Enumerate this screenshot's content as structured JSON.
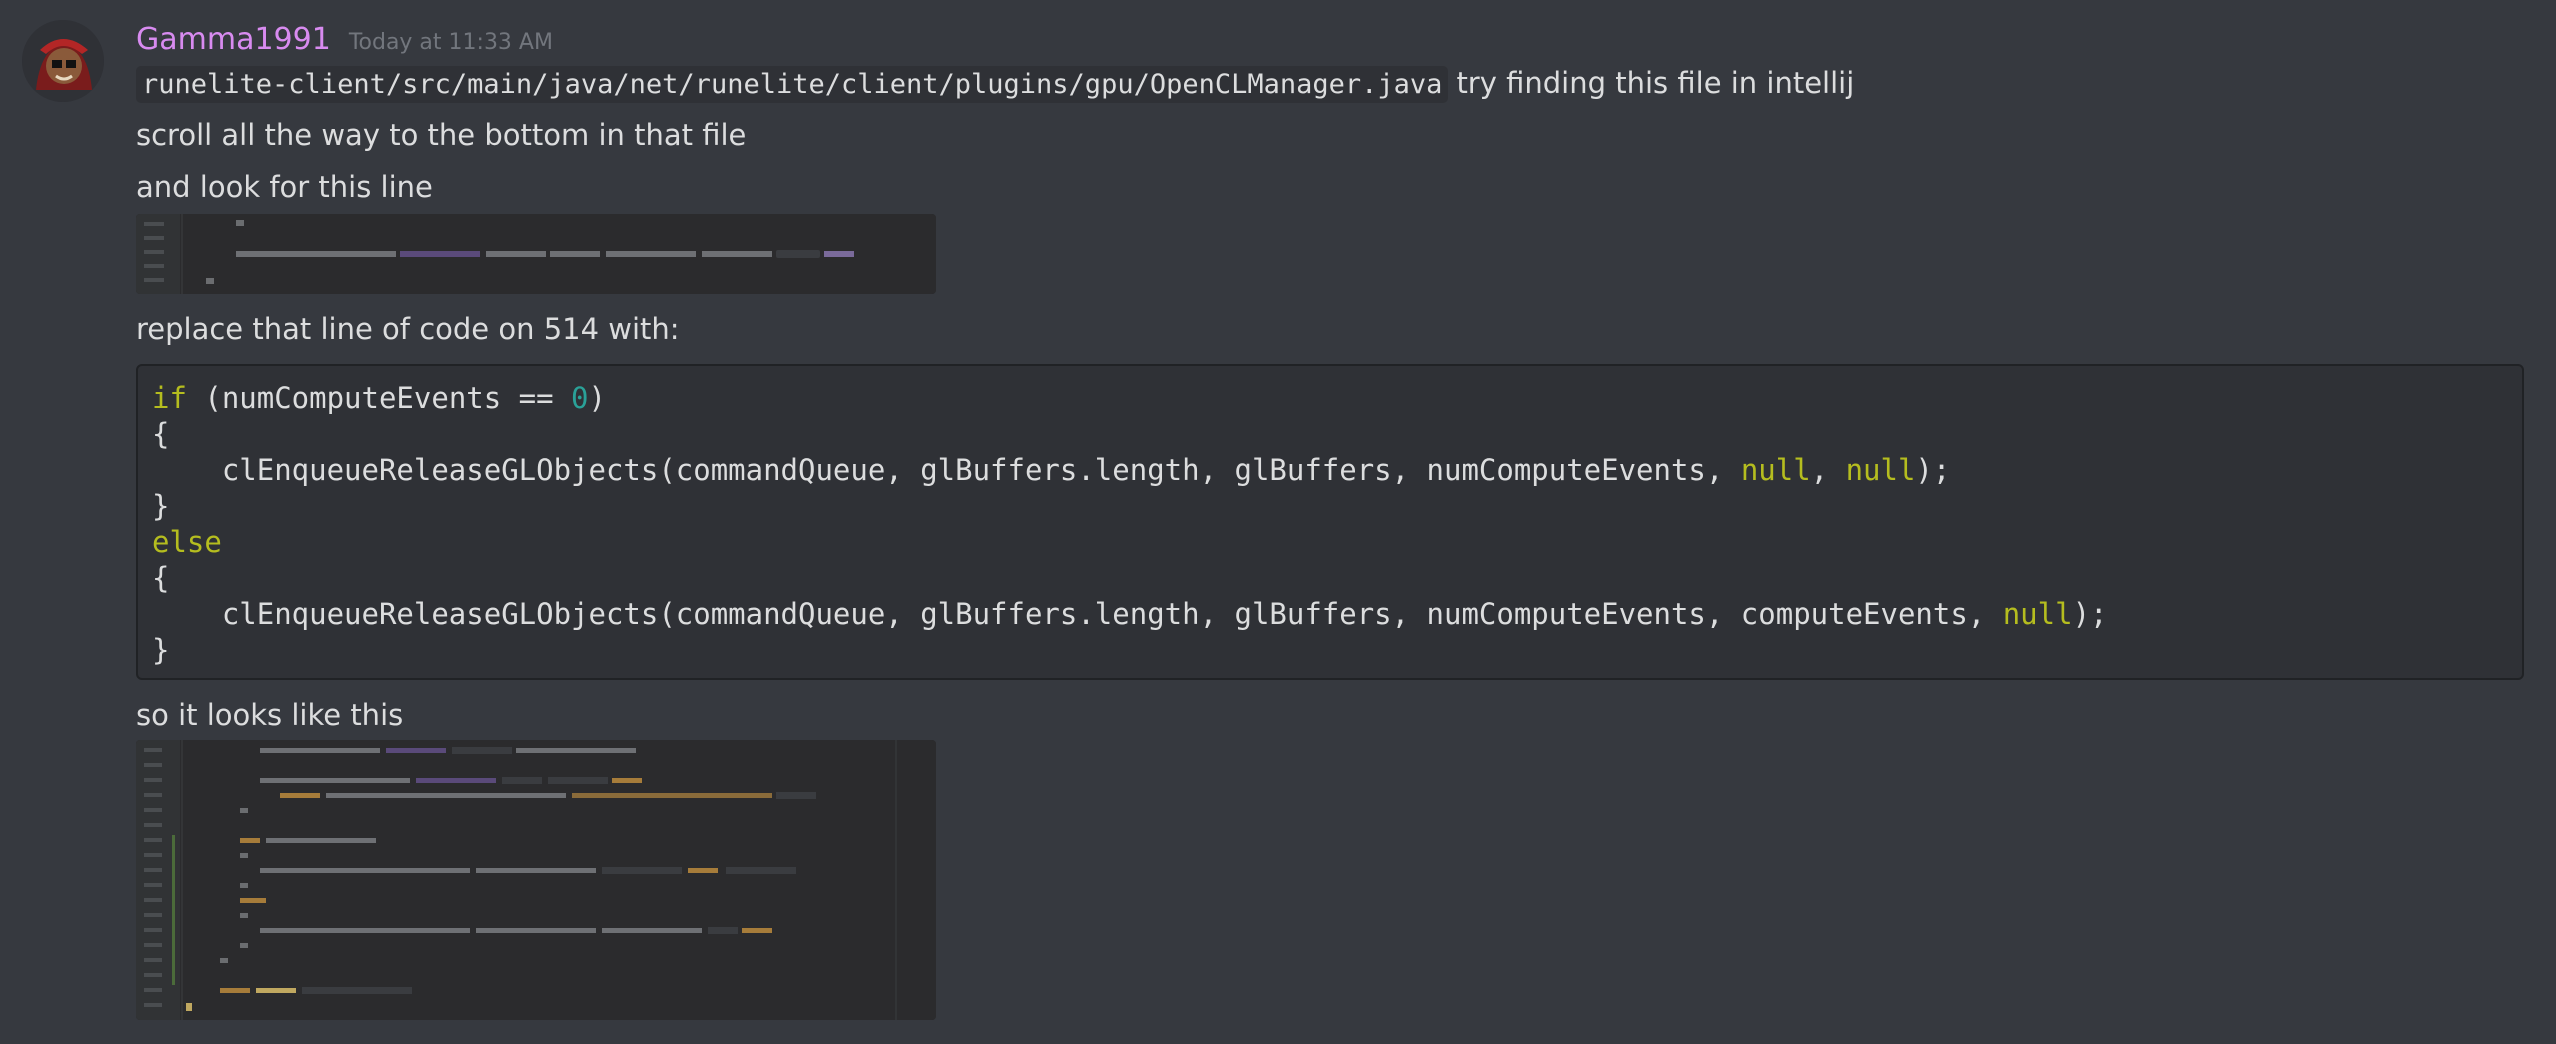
{
  "message": {
    "username": "Gamma1991",
    "timestamp": "Today at 11:33 AM",
    "lines": {
      "path": "runelite-client/src/main/java/net/runelite/client/plugins/gpu/OpenCLManager.java",
      "path_suffix": "try finding this file in intellij",
      "scroll": "scroll all the way to the bottom in that file",
      "look": "and look for this line",
      "replace": "replace that line of code on 514 with:",
      "result": "so it looks like this"
    },
    "code": {
      "l1_kw": "if",
      "l1_a": " (numComputeEvents == ",
      "l1_num": "0",
      "l1_b": ")",
      "l2": "{",
      "l3_a": "    clEnqueueReleaseGLObjects(commandQueue, glBuffers.length, glBuffers, numComputeEvents, ",
      "l3_null1": "null",
      "l3_sep": ", ",
      "l3_null2": "null",
      "l3_end": ");",
      "l4": "}",
      "l5_kw": "else",
      "l6": "{",
      "l7_a": "    clEnqueueReleaseGLObjects(commandQueue, glBuffers.length, glBuffers, numComputeEvents, computeEvents, ",
      "l7_null": "null",
      "l7_end": ");",
      "l8": "}"
    }
  }
}
